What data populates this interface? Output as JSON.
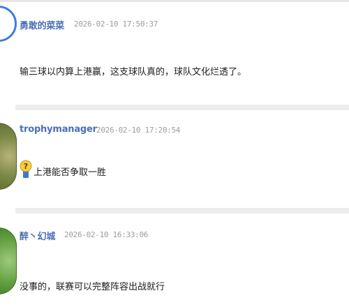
{
  "comments": [
    {
      "username": "勇敢的菜菜",
      "timestamp": "2026-02-10 17:50:37",
      "content": "输三球以内算上港赢，这支球队真的，球队文化烂透了。"
    },
    {
      "username": "trophymanager",
      "timestamp": "2026-02-10 17:20:54",
      "content": "上港能否争取一胜",
      "icon": "question-emoji-icon"
    },
    {
      "username": "醉丶幻城",
      "timestamp": "2026-02-10 16:33:06",
      "content": "没事的，联赛可以完整阵容出战就行"
    }
  ],
  "colors": {
    "username": "#4a6fb5",
    "timestamp": "#9c9c9c",
    "text": "#1c1c1c",
    "separator": "#ececec"
  }
}
